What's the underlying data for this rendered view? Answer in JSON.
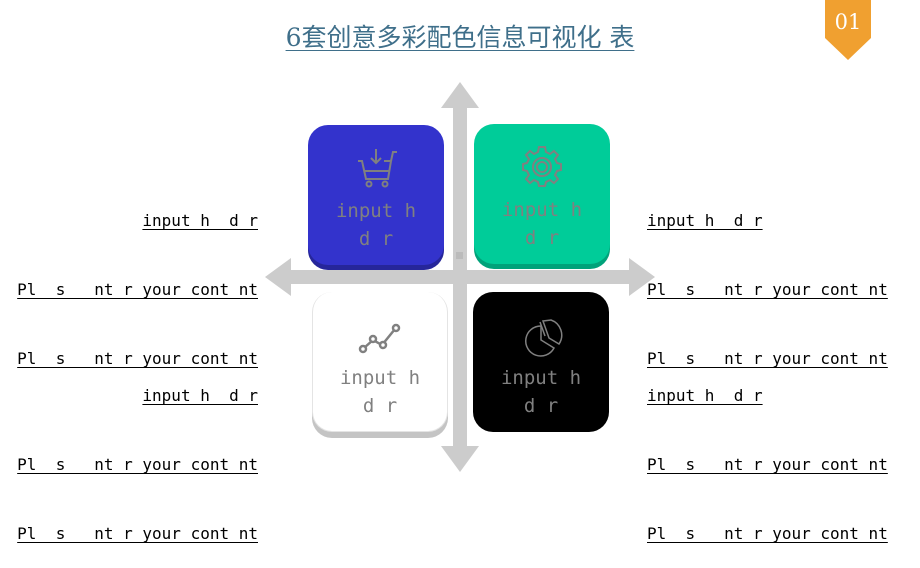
{
  "title": "6套创意多彩配色信息可视化  表",
  "badge": {
    "number": "01",
    "color": "#f0a030"
  },
  "colors": {
    "title": "#3f6f8a",
    "axis": "#cccccc",
    "tile_blue": "#3333cc",
    "tile_green": "#00cc99",
    "tile_white": "#ffffff",
    "tile_black": "#000000"
  },
  "tiles": [
    {
      "icon": "shopping-cart-icon",
      "label_line1": "input h",
      "label_line2": "d r"
    },
    {
      "icon": "gear-icon",
      "label_line1": "input h",
      "label_line2": "d r"
    },
    {
      "icon": "line-chart-icon",
      "label_line1": "input h",
      "label_line2": "d r"
    },
    {
      "icon": "pie-chart-icon",
      "label_line1": "input h",
      "label_line2": "d r"
    }
  ],
  "blocks": {
    "top_left": {
      "heading": "input h  d r",
      "line1": "Pl  s   nt r your cont nt",
      "line2": "Pl  s   nt r your cont nt"
    },
    "top_right": {
      "heading": "input h  d r",
      "line1": "Pl  s   nt r your cont nt",
      "line2": "Pl  s   nt r your cont nt"
    },
    "bottom_left": {
      "heading": "input h  d r",
      "line1": "Pl  s   nt r your cont nt",
      "line2": "Pl  s   nt r your cont nt"
    },
    "bottom_right": {
      "heading": "input h  d r",
      "line1": "Pl  s   nt r your cont nt",
      "line2": "Pl  s   nt r your cont nt"
    }
  }
}
